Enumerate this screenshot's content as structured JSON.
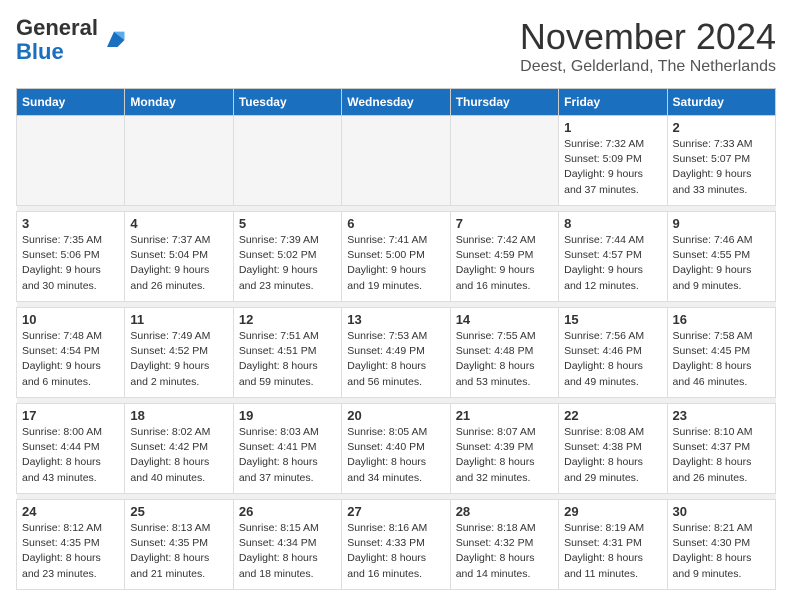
{
  "logo": {
    "general": "General",
    "blue": "Blue"
  },
  "title": "November 2024",
  "location": "Deest, Gelderland, The Netherlands",
  "weekdays": [
    "Sunday",
    "Monday",
    "Tuesday",
    "Wednesday",
    "Thursday",
    "Friday",
    "Saturday"
  ],
  "weeks": [
    [
      {
        "day": "",
        "info": ""
      },
      {
        "day": "",
        "info": ""
      },
      {
        "day": "",
        "info": ""
      },
      {
        "day": "",
        "info": ""
      },
      {
        "day": "",
        "info": ""
      },
      {
        "day": "1",
        "info": "Sunrise: 7:32 AM\nSunset: 5:09 PM\nDaylight: 9 hours\nand 37 minutes."
      },
      {
        "day": "2",
        "info": "Sunrise: 7:33 AM\nSunset: 5:07 PM\nDaylight: 9 hours\nand 33 minutes."
      }
    ],
    [
      {
        "day": "3",
        "info": "Sunrise: 7:35 AM\nSunset: 5:06 PM\nDaylight: 9 hours\nand 30 minutes."
      },
      {
        "day": "4",
        "info": "Sunrise: 7:37 AM\nSunset: 5:04 PM\nDaylight: 9 hours\nand 26 minutes."
      },
      {
        "day": "5",
        "info": "Sunrise: 7:39 AM\nSunset: 5:02 PM\nDaylight: 9 hours\nand 23 minutes."
      },
      {
        "day": "6",
        "info": "Sunrise: 7:41 AM\nSunset: 5:00 PM\nDaylight: 9 hours\nand 19 minutes."
      },
      {
        "day": "7",
        "info": "Sunrise: 7:42 AM\nSunset: 4:59 PM\nDaylight: 9 hours\nand 16 minutes."
      },
      {
        "day": "8",
        "info": "Sunrise: 7:44 AM\nSunset: 4:57 PM\nDaylight: 9 hours\nand 12 minutes."
      },
      {
        "day": "9",
        "info": "Sunrise: 7:46 AM\nSunset: 4:55 PM\nDaylight: 9 hours\nand 9 minutes."
      }
    ],
    [
      {
        "day": "10",
        "info": "Sunrise: 7:48 AM\nSunset: 4:54 PM\nDaylight: 9 hours\nand 6 minutes."
      },
      {
        "day": "11",
        "info": "Sunrise: 7:49 AM\nSunset: 4:52 PM\nDaylight: 9 hours\nand 2 minutes."
      },
      {
        "day": "12",
        "info": "Sunrise: 7:51 AM\nSunset: 4:51 PM\nDaylight: 8 hours\nand 59 minutes."
      },
      {
        "day": "13",
        "info": "Sunrise: 7:53 AM\nSunset: 4:49 PM\nDaylight: 8 hours\nand 56 minutes."
      },
      {
        "day": "14",
        "info": "Sunrise: 7:55 AM\nSunset: 4:48 PM\nDaylight: 8 hours\nand 53 minutes."
      },
      {
        "day": "15",
        "info": "Sunrise: 7:56 AM\nSunset: 4:46 PM\nDaylight: 8 hours\nand 49 minutes."
      },
      {
        "day": "16",
        "info": "Sunrise: 7:58 AM\nSunset: 4:45 PM\nDaylight: 8 hours\nand 46 minutes."
      }
    ],
    [
      {
        "day": "17",
        "info": "Sunrise: 8:00 AM\nSunset: 4:44 PM\nDaylight: 8 hours\nand 43 minutes."
      },
      {
        "day": "18",
        "info": "Sunrise: 8:02 AM\nSunset: 4:42 PM\nDaylight: 8 hours\nand 40 minutes."
      },
      {
        "day": "19",
        "info": "Sunrise: 8:03 AM\nSunset: 4:41 PM\nDaylight: 8 hours\nand 37 minutes."
      },
      {
        "day": "20",
        "info": "Sunrise: 8:05 AM\nSunset: 4:40 PM\nDaylight: 8 hours\nand 34 minutes."
      },
      {
        "day": "21",
        "info": "Sunrise: 8:07 AM\nSunset: 4:39 PM\nDaylight: 8 hours\nand 32 minutes."
      },
      {
        "day": "22",
        "info": "Sunrise: 8:08 AM\nSunset: 4:38 PM\nDaylight: 8 hours\nand 29 minutes."
      },
      {
        "day": "23",
        "info": "Sunrise: 8:10 AM\nSunset: 4:37 PM\nDaylight: 8 hours\nand 26 minutes."
      }
    ],
    [
      {
        "day": "24",
        "info": "Sunrise: 8:12 AM\nSunset: 4:35 PM\nDaylight: 8 hours\nand 23 minutes."
      },
      {
        "day": "25",
        "info": "Sunrise: 8:13 AM\nSunset: 4:35 PM\nDaylight: 8 hours\nand 21 minutes."
      },
      {
        "day": "26",
        "info": "Sunrise: 8:15 AM\nSunset: 4:34 PM\nDaylight: 8 hours\nand 18 minutes."
      },
      {
        "day": "27",
        "info": "Sunrise: 8:16 AM\nSunset: 4:33 PM\nDaylight: 8 hours\nand 16 minutes."
      },
      {
        "day": "28",
        "info": "Sunrise: 8:18 AM\nSunset: 4:32 PM\nDaylight: 8 hours\nand 14 minutes."
      },
      {
        "day": "29",
        "info": "Sunrise: 8:19 AM\nSunset: 4:31 PM\nDaylight: 8 hours\nand 11 minutes."
      },
      {
        "day": "30",
        "info": "Sunrise: 8:21 AM\nSunset: 4:30 PM\nDaylight: 8 hours\nand 9 minutes."
      }
    ]
  ]
}
